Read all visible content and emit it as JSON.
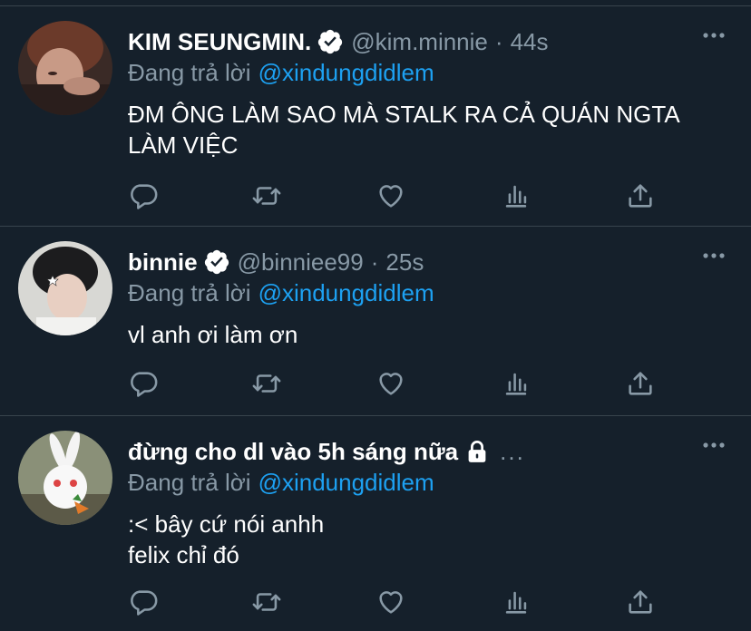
{
  "colors": {
    "background": "#15202b",
    "divider": "#38444d",
    "muted": "#8899a6",
    "link": "#1da1f2",
    "text": "#ffffff"
  },
  "reply_prefix": "Đang trả lời",
  "tweets": [
    {
      "display_name": "KIM SEUNGMIN.",
      "badge": "verified-icon",
      "handle": "@kim.minnie",
      "separator": "·",
      "time": "44s",
      "reply_to": "@xindungdidlem",
      "text_lines": [
        "ĐM ÔNG LÀM SAO MÀ STALK RA CẢ QUÁN NGTA",
        "LÀM VIỆC"
      ]
    },
    {
      "display_name": "binnie",
      "badge": "verified-icon",
      "handle": "@binniee99",
      "separator": "·",
      "time": "25s",
      "reply_to": "@xindungdidlem",
      "text_lines": [
        "vl anh ơi làm ơn"
      ]
    },
    {
      "display_name": "đừng cho dl vào 5h sáng nữa",
      "badge": "lock-icon",
      "truncation": "...",
      "reply_to": "@xindungdidlem",
      "text_lines": [
        ":< bây cứ nói anhh",
        "felix chỉ đó"
      ]
    }
  ],
  "actions": [
    "reply-icon",
    "retweet-icon",
    "like-icon",
    "analytics-icon",
    "share-icon"
  ]
}
